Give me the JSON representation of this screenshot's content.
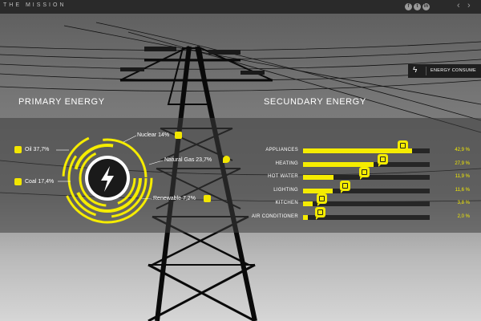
{
  "topbar": {
    "brand": "THE MISSION",
    "social": [
      "f",
      "t",
      "in"
    ],
    "prev": "‹",
    "next": "›"
  },
  "consume_tag": {
    "icon": "bolt-icon",
    "label": "ENERGY CONSUME"
  },
  "primary": {
    "title": "PRIMARY ENERGY",
    "sources": [
      {
        "label": "Oil 37,7%",
        "icon": "oil-barrel-icon"
      },
      {
        "label": "Coal 17,4%",
        "icon": "coal-icon"
      },
      {
        "label": "Nuclear 14%",
        "icon": "nuclear-plant-icon"
      },
      {
        "label": "Natural Gas 23,7%",
        "icon": "gas-flame-icon"
      },
      {
        "label": "Renewable 7,2%",
        "icon": "recycle-icon"
      }
    ],
    "center_icon": "bolt-icon"
  },
  "secondary": {
    "title": "SECUNDARY ENERGY",
    "rows": [
      {
        "label": "APPLIANCES",
        "value": 42.9,
        "text": "42,9 %",
        "icon": "tv-icon"
      },
      {
        "label": "HEATING",
        "value": 27.9,
        "text": "27,9 %",
        "icon": "flame-icon"
      },
      {
        "label": "HOT WATER",
        "value": 11.9,
        "text": "11,9 %",
        "icon": "thermometer-icon"
      },
      {
        "label": "LIGHTING",
        "value": 11.6,
        "text": "11,6 %",
        "icon": "phone-icon"
      },
      {
        "label": "KITCHEN",
        "value": 3.8,
        "text": "3,8 %",
        "icon": "kitchen-icon"
      },
      {
        "label": "AIR CONDITIONER",
        "value": 2.0,
        "text": "2,0 %",
        "icon": "air-conditioner-icon"
      }
    ]
  },
  "colors": {
    "accent": "#f5ec00",
    "bar_track": "#262626",
    "topbar": "#2a2a2a"
  }
}
